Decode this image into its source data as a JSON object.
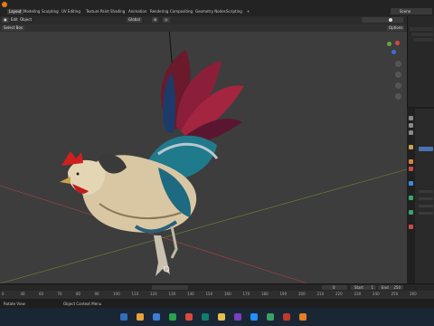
{
  "workspace_tabs": [
    "Layout",
    "Modeling",
    "Sculpting",
    "UV Editing",
    "Texture Paint",
    "Shading",
    "Animation",
    "Rendering",
    "Compositing",
    "Geometry Nodes",
    "Scripting",
    "+"
  ],
  "active_tab_index": 0,
  "top_right": {
    "scene_label": "Scene"
  },
  "viewport_header": {
    "edit_label": "Edit",
    "object_label": "Object",
    "transform_orientation": "Global",
    "select_mode": "Select Box",
    "options_label": "Options"
  },
  "timeline": {
    "ticks": [
      "0",
      "40",
      "60",
      "70",
      "80",
      "90",
      "100",
      "110",
      "120",
      "130",
      "140",
      "150",
      "160",
      "170",
      "180",
      "190",
      "200",
      "210",
      "220",
      "230",
      "240",
      "250",
      "260"
    ],
    "current_frame": "0",
    "start_label": "Start",
    "start_value": "1",
    "end_label": "End",
    "end_value": "250"
  },
  "status": {
    "left": "Rotate View",
    "middle": "Object Context Menu"
  },
  "taskbar_colors": [
    "#2c6fbd",
    "#e8a23a",
    "#3b7dd8",
    "#2aa14b",
    "#d94a3b",
    "#0f7d6e",
    "#e5c04c",
    "#7a3fbf",
    "#1e90ff",
    "#38a169",
    "#c0392b",
    "#e67e22"
  ],
  "taskbar_icon_names": [
    "windows-start-icon",
    "search-icon",
    "task-view-icon",
    "explorer-icon",
    "edge-icon",
    "store-icon",
    "mail-icon",
    "photos-icon",
    "chrome-icon",
    "excel-icon",
    "word-icon",
    "blender-icon"
  ]
}
